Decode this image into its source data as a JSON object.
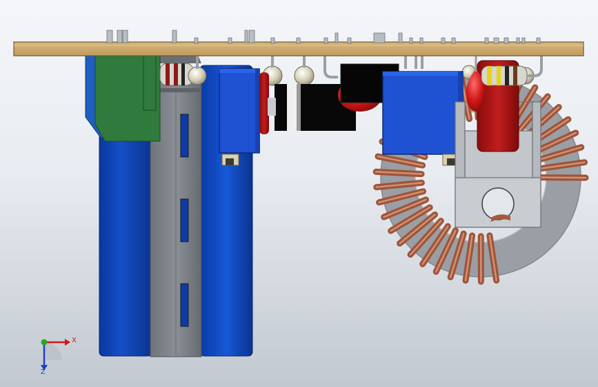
{
  "viewport": {
    "background_top": "#f4f6f9",
    "background_bottom": "#c2c8d0"
  },
  "triad": {
    "x_label": "X",
    "z_label": "Z",
    "x_color": "#d01717",
    "z_color": "#1f3ec8",
    "y_color": "#2aa52a"
  },
  "colors": {
    "pcb": "#c9a66b",
    "capacitor_blue": "#0b3fb0",
    "bracket_gray": "#777c83",
    "green_part": "#2f7a3c",
    "terminal_blue": "#1c4fcf",
    "toroid_gray": "#a4a8ad",
    "copper": "#a35a3e",
    "red_part": "#b51616",
    "black_part": "#0c0c0c"
  }
}
